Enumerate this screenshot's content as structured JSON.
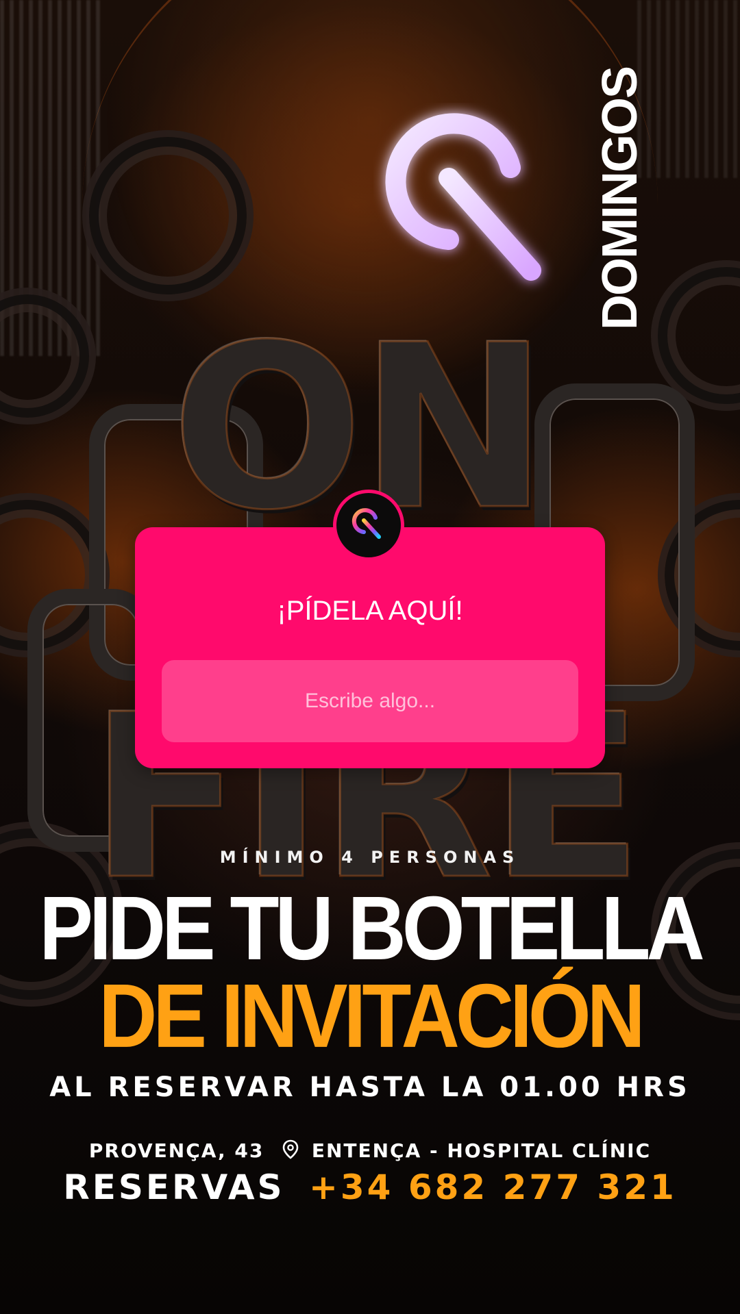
{
  "brand": {
    "logo_icon": "neon-circle-arrow-logo",
    "logo_wordmark": "DOMINGOS"
  },
  "background": {
    "headline_top": "ON",
    "headline_bottom": "FIRE"
  },
  "question_sticker": {
    "avatar_icon": "brand-logo-icon",
    "title": "¡PÍDELA AQUÍ!",
    "placeholder": "Escribe algo...",
    "value": ""
  },
  "promo": {
    "min_people": "MÍNIMO 4 PERSONAS",
    "headline_line1": "PIDE TU BOTELLA",
    "headline_line2": "DE INVITACIÓN",
    "condition": "AL RESERVAR HASTA LA 01.00 HRS"
  },
  "contact": {
    "address": "PROVENÇA, 43",
    "location_icon": "map-pin-icon",
    "area": "ENTENÇA - HOSPITAL CLÍNIC",
    "reservations_label": "RESERVAS",
    "phone": "+34 682 277 321"
  },
  "colors": {
    "sticker_pink": "#ff0a6c",
    "accent_orange": "#ffa114",
    "logo_glow": "#e7c6ff"
  }
}
